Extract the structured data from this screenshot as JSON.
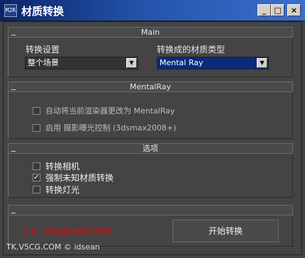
{
  "window": {
    "title": "材质转换",
    "icon_text": "M2R",
    "min_glyph": "_",
    "max_glyph": "□",
    "close_glyph": "×"
  },
  "main": {
    "collapse_glyph": "_",
    "title": "Main",
    "convert_settings_label": "转换设置",
    "convert_settings_value": "整个场景",
    "target_type_label": "转换成的材质类型",
    "target_type_value": "Mental Ray"
  },
  "mentalray": {
    "collapse_glyph": "_",
    "title": "MentalRay",
    "auto_renderer": {
      "label": "自动将当前渲染器更改为 MentalRay",
      "checked": false
    },
    "exposure": {
      "label": "启用 摄影曝光控制 (3dsmax2008+)",
      "checked": false
    }
  },
  "options": {
    "collapse_glyph": "_",
    "title": "选项",
    "items": [
      {
        "label": "转换相机",
        "checked": false
      },
      {
        "label": "强制未知材质转换",
        "checked": true
      },
      {
        "label": "转换灯光",
        "checked": false
      }
    ]
  },
  "bottom": {
    "collapse_glyph": "_",
    "warning": "注意: [转换前请备份场景]",
    "start_button": "开始转换",
    "footer": "TK.V5CG.COM © idsean"
  },
  "colors": {
    "titlebar_start": "#0a246a",
    "titlebar_end": "#3b6fd0",
    "background": "#444444",
    "warning": "#d01010",
    "selected_dropdown": "#0b2a7a"
  }
}
